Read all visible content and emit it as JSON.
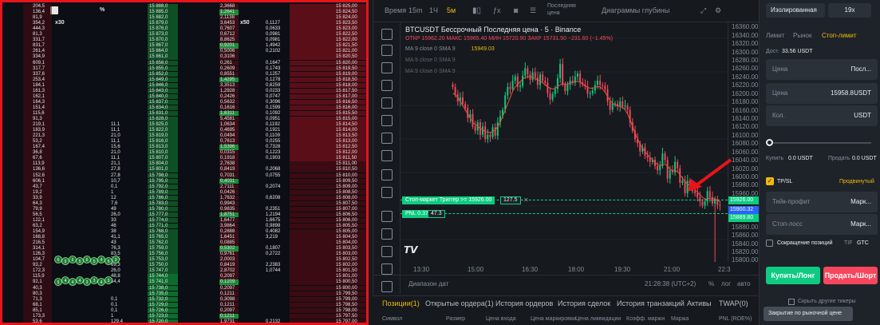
{
  "dom_panel": {
    "multiplier_left": "x30",
    "multiplier_right": "x50",
    "percent_icon": "%",
    "prices": [
      "15 888,0",
      "15 885,0",
      "15 882,0",
      "15 879,0",
      "15 876,0",
      "15 873,0",
      "15 870,0",
      "15 867,0",
      "15 864,0",
      "15 861,0",
      "15 858,0",
      "15 855,0",
      "15 852,0",
      "15 849,0",
      "15 846,0",
      "15 843,0",
      "15 840,0",
      "15 837,0",
      "15 834,0",
      "15 831,0",
      "15 828,0",
      "15 825,0",
      "15 822,0",
      "15 819,0",
      "15 816,0",
      "15 813,0",
      "15 810,0",
      "15 807,0",
      "15 804,0",
      "15 801,0",
      "15 798,0",
      "15 795,0",
      "15 792,0",
      "15 789,0",
      "15 786,0",
      "15 783,0",
      "15 780,0",
      "15 777,0",
      "15 774,0",
      "15 771,0",
      "15 768,0",
      "15 765,0",
      "15 762,0",
      "15 759,0",
      "15 756,0",
      "15 753,0",
      "15 750,0",
      "15 747,0",
      "15 744,0",
      "15 741,0",
      "15 738,0",
      "15 735,0",
      "15 732,0",
      "15 729,0",
      "15 726,0",
      "15 723,0",
      "15 720,0"
    ],
    "prices_right": [
      "15 825,00",
      "15 824,50",
      "15 824,00",
      "15 823,50",
      "15 823,00",
      "15 822,50",
      "15 822,00",
      "15 821,50",
      "15 821,00",
      "15 820,50",
      "15 820,00",
      "15 819,50",
      "15 819,00",
      "15 818,50",
      "15 818,00",
      "15 817,50",
      "15 817,00",
      "15 816,50",
      "15 816,00",
      "15 815,50",
      "15 815,00",
      "15 814,50",
      "15 814,00",
      "15 813,50",
      "15 813,00",
      "15 812,50",
      "15 812,00",
      "15 811,50",
      "15 811,00",
      "15 810,50",
      "15 810,00",
      "15 809,50",
      "15 809,00",
      "15 808,50",
      "15 808,00",
      "15 807,50",
      "15 807,00",
      "15 806,50",
      "15 806,00",
      "15 805,50",
      "15 805,00",
      "15 804,50",
      "15 804,00",
      "15 803,50",
      "15 803,00",
      "15 802,50",
      "15 802,00",
      "15 801,50",
      "15 801,00",
      "15 800,50",
      "15 800,00",
      "15 799,50",
      "15 799,00",
      "15 798,50",
      "15 798,00",
      "15 797,50",
      "15 797,00"
    ],
    "left_vols": [
      "204,5",
      "136,4",
      "81,9",
      "354,2",
      "444,3",
      "81,3",
      "331,7",
      "831,7",
      "261,4",
      "334,9",
      "609,1",
      "317,7",
      "337,6",
      "253,4",
      "184,1",
      "161,3",
      "162,1",
      "164,3",
      "151,4",
      "115,6",
      "91,3",
      "219,1",
      "183,9",
      "221,3",
      "53,2",
      "167,4",
      "36,8",
      "67,6",
      "113,9",
      "136,6",
      "152,6",
      "606,1",
      "43,7",
      "19,2",
      "33,9",
      "64,3",
      "79,9",
      "56,5",
      "122,1",
      "63,2",
      "154,9",
      "168,8",
      "216,5",
      "314,1",
      "126,3",
      "104,7",
      "93,2",
      "172,3",
      "115,9",
      "92,1",
      "40,3",
      "80,3",
      "71,3",
      "68,1",
      "85,1",
      "173,3",
      "53,6"
    ],
    "mid_vols": [
      "",
      "",
      "",
      "",
      "",
      "",
      "",
      "",
      "",
      "",
      "",
      "",
      "",
      "",
      "",
      "",
      "",
      "",
      "",
      "",
      "",
      "11,1",
      "11,1",
      "21,0",
      "11,1",
      "15,6",
      "21,0",
      "11,1",
      "21,1",
      "27,8",
      "27,8",
      "10,7",
      "0,1",
      "1",
      "12",
      "7,6",
      "49",
      "26,0",
      "33",
      "46",
      "38",
      "41,1",
      "43",
      "76,3",
      "83,5",
      "72,5",
      "69,3",
      "26,0",
      "48,8",
      "54,4",
      "",
      "",
      "0,1",
      "0,1",
      "0,1",
      "1",
      "129,4"
    ],
    "right_vols": [
      "2,3668",
      "1,2641",
      "2,1138",
      "3,6453",
      "0,7607",
      "0,6712",
      "8,8625",
      "0,9201",
      "0,5006",
      "0,3106",
      "0,261",
      "0,2609",
      "0,8551",
      "1,4295",
      "3,3513",
      "1,2928",
      "0,2426",
      "0,5632",
      "0,1616",
      "1,6311",
      "5,4581",
      "1,0634",
      "0,4695",
      "0,0494",
      "0,7613",
      "1,5396",
      "0,0315",
      "0,1918",
      "2,7638",
      "0,8419",
      "0,7031",
      "0,4031",
      "2,7111",
      "0,0426",
      "1,7632",
      "0,9943",
      "0,9835",
      "1,8751",
      "1,6477",
      "3,9864",
      "0,2888",
      "1,6451",
      "0,0885",
      "0,5302",
      "0,9761",
      "2,0003",
      "0,8419",
      "2,8702",
      "0,2097",
      "0,1209",
      "0,2097",
      "0,1211",
      "0,3098",
      "0,1211",
      "0,2097",
      "0,1211",
      "1,9731"
    ],
    "far_vols": [
      "",
      "",
      "",
      "0,1127",
      "0,0633",
      "0,0981",
      "0,0981",
      "1,4942",
      "0,2102",
      "",
      "0,1647",
      "0,1743",
      "0,1257",
      "0,1278",
      "0,6259",
      "0,0233",
      "0,0747",
      "0,3096",
      "0,1599",
      "0,1092",
      "0,0951",
      "0,1192",
      "0,1921",
      "0,1109",
      "0,0255",
      "0,7328",
      "0,1223",
      "0,1903",
      "",
      "0,2068",
      "0,0755",
      "",
      "0,2074",
      "",
      "0,6208",
      "",
      "0,2351",
      "1,2194",
      "1,6675",
      "0,9898",
      "0,4082",
      "3,219",
      "",
      "0,1807",
      "0,2722",
      "",
      "2,2383",
      "1,0744",
      "",
      "",
      "",
      "",
      "",
      "",
      "",
      "",
      "0,2132"
    ],
    "bubbles": [
      "6",
      "5",
      "6",
      "5",
      "6",
      "5",
      "4",
      "5",
      "3",
      "5",
      "4",
      "4",
      "4",
      "3",
      "3",
      "4",
      "3"
    ]
  },
  "toolbar": {
    "time_label": "Время",
    "intervals": [
      "15m",
      "1Ч",
      "5м"
    ],
    "dropdown": "Последняя цена",
    "depth_chart": "Диаграммы глубины"
  },
  "chart_header": {
    "title": "BTCUSDT Бессрочный Последняя цена · 5 · Binance",
    "ohlc": "ОТКР 15962.20 МАКС 15965.40 МИН 15720.90 ЗАКР 15731.50 −231.60 (−1.45%)",
    "ma1": "MA 9 close 0 SMA 9",
    "ma1_value": "15949.03",
    "ma2": "MA 9 close 0 SMA 9",
    "ma3": "MA 9 close 0 SMA 9"
  },
  "chart_data": {
    "type": "candlestick",
    "y_ticks": [
      "16360.00",
      "16340.00",
      "16320.00",
      "16300.00",
      "16280.00",
      "16260.00",
      "16240.00",
      "16220.00",
      "16200.00",
      "16180.00",
      "16160.00",
      "16140.00",
      "16120.00",
      "16100.00",
      "16080.00",
      "16060.00",
      "16040.00",
      "16020.00",
      "16000.00",
      "15980.00",
      "15960.00",
      "15940.00",
      "15920.00",
      "15900.00",
      "15880.00",
      "15860.00",
      "15840.00",
      "15820.00",
      "15800.00"
    ],
    "x_ticks": [
      "13:30",
      "15:00",
      "16:30",
      "18:00",
      "19:30",
      "21:00",
      "22:3"
    ],
    "ylim": [
      15795,
      16370
    ],
    "closes": [
      16215,
      16198,
      16180,
      16190,
      16175,
      16165,
      16140,
      16150,
      16120,
      16110,
      16130,
      16100,
      16120,
      16090,
      16100,
      16095,
      16118,
      16098,
      16130,
      16145,
      16160,
      16195,
      16215,
      16210,
      16230,
      16240,
      16215,
      16218,
      16242,
      16260,
      16245,
      16232,
      16250,
      16238,
      16220,
      16245,
      16230,
      16225,
      16200,
      16185,
      16198,
      16210,
      16236,
      16270,
      16222,
      16205,
      16220,
      16230,
      16225,
      16240,
      16247,
      16226,
      16221,
      16216,
      16199,
      16200,
      16206,
      16220,
      16230,
      16220,
      16218,
      16210,
      16180,
      16160,
      16175,
      16175,
      16168,
      16180,
      16168,
      16170,
      16160,
      16130,
      16110,
      16090,
      16080,
      16060,
      16070,
      16050,
      16045,
      16035,
      16040,
      16025,
      16015,
      16025,
      16055,
      16040,
      15995,
      16015,
      16010,
      16035,
      16020,
      15985,
      15990,
      15960,
      15990,
      15980,
      15965,
      15960,
      15950,
      15940,
      15930,
      15940,
      15965,
      15950,
      15935,
      15946,
      15932,
      15930
    ],
    "ma_line": [
      16200,
      16196,
      16190,
      16180,
      16170,
      16160,
      16150,
      16140,
      16130,
      16125,
      16120,
      16115,
      16112,
      16108,
      16106,
      16106,
      16108,
      16112,
      16120,
      16130,
      16145,
      16160,
      16175,
      16190,
      16205,
      16215,
      16222,
      16228,
      16234,
      16238,
      16240,
      16240,
      16238,
      16235,
      16232,
      16230,
      16225,
      16220,
      16215,
      16212,
      16210,
      16212,
      16216,
      16220,
      16222,
      16222,
      16222,
      16224,
      16226,
      16228,
      16228,
      16226,
      16222,
      16218,
      16214,
      16212,
      16212,
      16214,
      16216,
      16215,
      16210,
      16202,
      16192,
      16182,
      16176,
      16172,
      16170,
      16168,
      16166,
      16160,
      16150,
      16136,
      16120,
      16104,
      16090,
      16078,
      16068,
      16060,
      16052,
      16046,
      16040,
      16034,
      16028,
      16026,
      16028,
      16030,
      16024,
      16018,
      16014,
      16014,
      16012,
      16004,
      15996,
      15988,
      15982,
      15978,
      15972,
      15968,
      15962,
      15956,
      15950,
      15946,
      15946,
      15948,
      15948,
      15946,
      15942,
      15940
    ]
  },
  "chart_overlays": {
    "stop_market_label": "Стоп-маркет Триггер >= 15926.00",
    "stop_qty": "127.5",
    "pnl_label": "PNL 0.37",
    "pnl_qty": "47.3",
    "price_tag_1": "15926.00",
    "price_tag_2": "15900.32",
    "price_tag_3": "15889.80",
    "date_range": "Диапазон дат",
    "clock": "21:28:38 (UTC+2)",
    "percent": "%",
    "log": "лог",
    "auto": "авто"
  },
  "bottom_tabs": {
    "tabs": [
      "Позиции(1)",
      "Открытые ордера(1)",
      "История ордеров",
      "История сделок",
      "История транзакций",
      "Активы",
      "TWAP(0)"
    ],
    "hide_pairs": "Скрыть другие тикеры",
    "headers": [
      "Символ",
      "Размер",
      "Цена входа",
      "Цена маркировки",
      "Цена ликвидации",
      "Коэфф. маржи",
      "Маржа",
      "PNL (ROE%)"
    ]
  },
  "order_panel": {
    "margin_mode": "Изолированная",
    "leverage": "19x",
    "types": [
      "Лимит",
      "Рынок",
      "Стоп-лимит"
    ],
    "available_label": "Дост.",
    "available_value": "33.56 USDT",
    "price_label": "Цена",
    "price_value": "Посл...",
    "price2_label": "Цена",
    "price2_value": "15958.8",
    "price2_unit": "USDT",
    "qty_label": "Кол.",
    "qty_unit": "USDT",
    "buy_label": "Купить",
    "buy_value": "0.0 USDT",
    "sell_label": "Продать",
    "sell_value": "0.0 USDT",
    "tpsl": "TP/SL",
    "advanced": "Продвинутый",
    "take_profit": "Тейк-профит",
    "tp_mode": "Марк...",
    "stop_loss": "Стоп-лосс",
    "sl_mode": "Марк...",
    "reduce_only": "Сокращение позиций",
    "tif": "TIF",
    "tif_value": "GTC",
    "buy_button": "Купить/Лонг",
    "sell_button": "Продать/Шорт",
    "tooltip": "Закрытие по рыночной цене"
  },
  "colors": {
    "accent": "#f0b90b",
    "up": "#0ecb81",
    "down": "#f6465d",
    "frame": "#e8141b"
  }
}
